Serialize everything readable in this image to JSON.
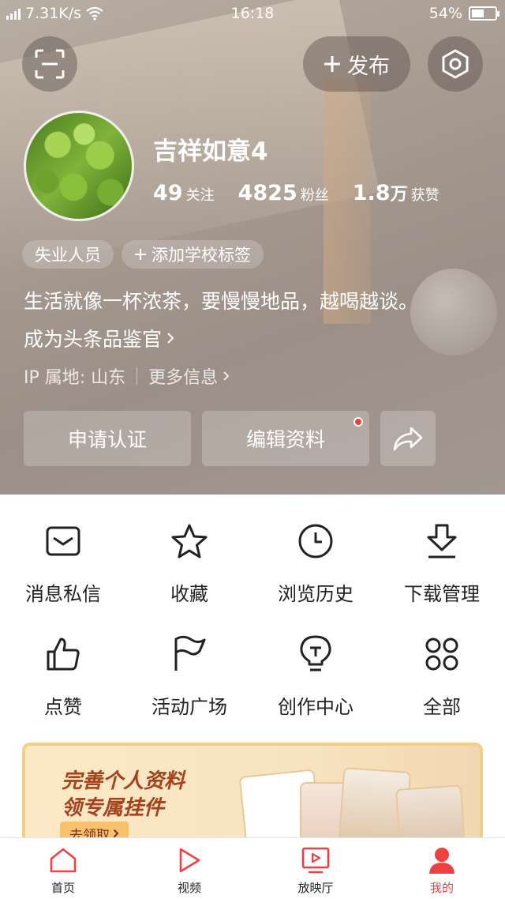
{
  "status_bar": {
    "network": "4G",
    "speed": "7.31K/s",
    "time": "16:18",
    "battery": "54%",
    "battery_level": 0.54
  },
  "top_bar": {
    "scan_icon": "scan-icon",
    "publish_label": "发布",
    "settings_icon": "hexagon-settings-icon"
  },
  "profile": {
    "username": "吉祥如意4",
    "stats": [
      {
        "value": "49",
        "unit": "",
        "label": "关注"
      },
      {
        "value": "4825",
        "unit": "",
        "label": "粉丝"
      },
      {
        "value": "1.8",
        "unit": "万",
        "label": "获赞"
      }
    ],
    "tags": [
      {
        "label": "失业人员"
      },
      {
        "label": "添加学校标签"
      }
    ],
    "bio": "生活就像一杯浓茶，要慢慢地品，越喝越谈。",
    "judge_link": "成为头条品鉴官",
    "ip_location": "IP 属地: 山东",
    "more_info": "更多信息"
  },
  "actions": {
    "certify": "申请认证",
    "edit_profile": "编辑资料",
    "share_icon": "share-arrow-icon"
  },
  "menu": [
    {
      "label": "消息私信",
      "icon": "message-envelope-icon"
    },
    {
      "label": "收藏",
      "icon": "star-icon"
    },
    {
      "label": "浏览历史",
      "icon": "clock-icon"
    },
    {
      "label": "下载管理",
      "icon": "download-icon"
    },
    {
      "label": "点赞",
      "icon": "thumbs-up-icon"
    },
    {
      "label": "活动广场",
      "icon": "flag-icon"
    },
    {
      "label": "创作中心",
      "icon": "lightbulb-icon"
    },
    {
      "label": "全部",
      "icon": "grid-dots-icon"
    }
  ],
  "banner": {
    "line1": "完善个人资料",
    "line2": "领专属挂件",
    "cta": "去领取"
  },
  "tabbar": [
    {
      "label": "首页",
      "icon": "home-icon"
    },
    {
      "label": "视频",
      "icon": "play-icon"
    },
    {
      "label": "放映厅",
      "icon": "tv-icon"
    },
    {
      "label": "我的",
      "icon": "person-icon",
      "active": true
    }
  ],
  "colors": {
    "accent": "#f04142",
    "banner_text": "#a4421d"
  }
}
